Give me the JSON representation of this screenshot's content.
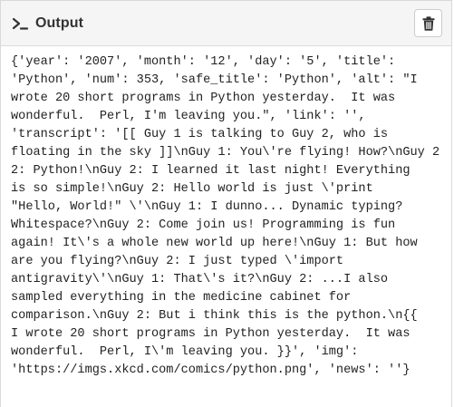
{
  "header": {
    "title": "Output",
    "prompt_icon": "terminal-prompt-icon",
    "delete_icon": "trash-icon"
  },
  "output": {
    "lines": [
      "{'year': '2007', 'month': '12', 'day': '5', 'title':",
      "'Python', 'num': 353, 'safe_title': 'Python', 'alt': \"I",
      "wrote 20 short programs in Python yesterday.  It was",
      "wonderful.  Perl, I'm leaving you.\", 'link': '',",
      "'transcript': '[[ Guy 1 is talking to Guy 2, who is",
      "floating in the sky ]]\\nGuy 1: You\\'re flying! How?\\nGuy 2",
      "2: Python!\\nGuy 2: I learned it last night! Everything",
      "is so simple!\\nGuy 2: Hello world is just \\'print",
      "\"Hello, World!\" \\'\\nGuy 1: I dunno... Dynamic typing?",
      "Whitespace?\\nGuy 2: Come join us! Programming is fun",
      "again! It\\'s a whole new world up here!\\nGuy 1: But how",
      "are you flying?\\nGuy 2: I just typed \\'import",
      "antigravity\\'\\nGuy 1: That\\'s it?\\nGuy 2: ...I also",
      "sampled everything in the medicine cabinet for",
      "comparison.\\nGuy 2: But i think this is the python.\\n{{",
      "I wrote 20 short programs in Python yesterday.  It was",
      "wonderful.  Perl, I\\'m leaving you. }}', 'img':",
      "'https://imgs.xkcd.com/comics/python.png', 'news': ''}"
    ]
  }
}
